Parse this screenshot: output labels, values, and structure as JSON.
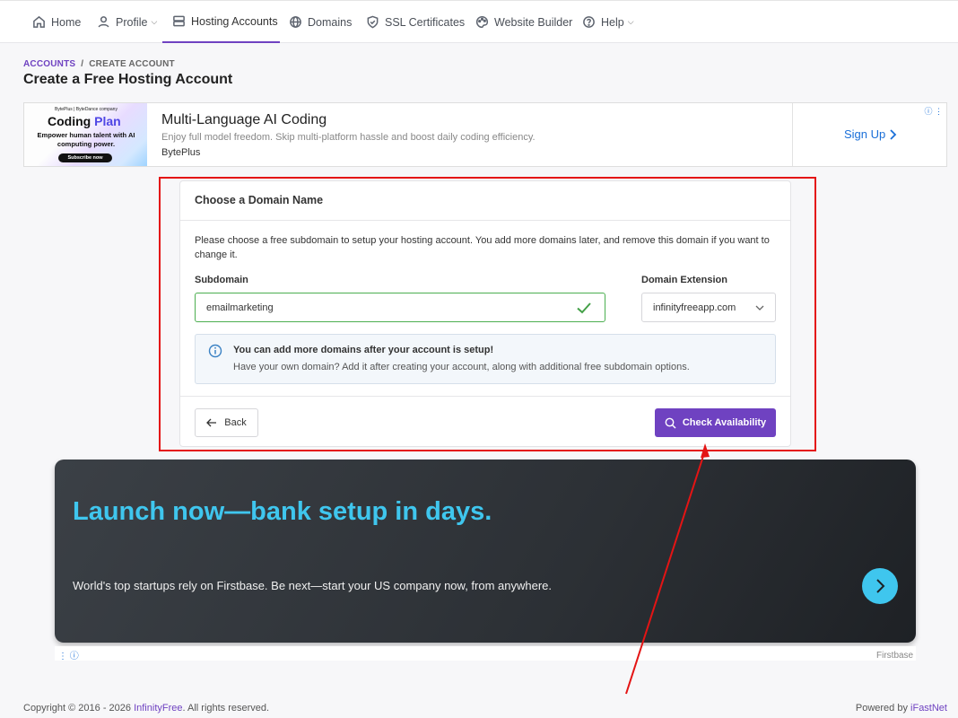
{
  "nav": {
    "items": [
      {
        "label": "Home"
      },
      {
        "label": "Profile"
      },
      {
        "label": "Hosting Accounts"
      },
      {
        "label": "Domains"
      },
      {
        "label": "SSL Certificates"
      },
      {
        "label": "Website Builder"
      },
      {
        "label": "Help"
      }
    ]
  },
  "breadcrumb": {
    "parent": "ACCOUNTS",
    "separator": "/",
    "current": "CREATE ACCOUNT"
  },
  "page_title": "Create a Free Hosting Account",
  "ad_top": {
    "thumb_brand": "BytePlus | ByteDance company",
    "thumb_plan": "Coding",
    "thumb_plan_accent": "Plan",
    "thumb_tagline": "Empower human talent with AI computing power.",
    "thumb_cta": "Subscribe now",
    "headline": "Multi-Language AI Coding",
    "description": "Enjoy full model freedom. Skip multi-platform hassle and boost daily coding efficiency.",
    "advertiser": "BytePlus",
    "cta": "Sign Up"
  },
  "card": {
    "title": "Choose a Domain Name",
    "intro": "Please choose a free subdomain to setup your hosting account. You add more domains later, and remove this domain if you want to change it.",
    "subdomain_label": "Subdomain",
    "subdomain_value": "emailmarketing",
    "extension_label": "Domain Extension",
    "extension_value": "infinityfreeapp.com",
    "info_title": "You can add more domains after your account is setup!",
    "info_text": "Have your own domain? Add it after creating your account, along with additional free subdomain options.",
    "back_label": "Back",
    "check_label": "Check Availability"
  },
  "ad_bottom": {
    "headline": "Launch now—bank setup in days.",
    "body": "World's top startups rely on Firstbase. Be next—start your US company now, from anywhere.",
    "sponsor": "Firstbase"
  },
  "footer": {
    "copyright_prefix": "Copyright © 2016 - 2026 ",
    "copyright_brand": "InfinityFree",
    "copyright_suffix": ". All rights reserved.",
    "powered_prefix": "Powered by ",
    "powered_brand": "iFastNet"
  },
  "colors": {
    "accent": "#6f42c1",
    "success": "#4caf50",
    "annotation": "#e41414",
    "ad_accent": "#3fc6ee"
  }
}
